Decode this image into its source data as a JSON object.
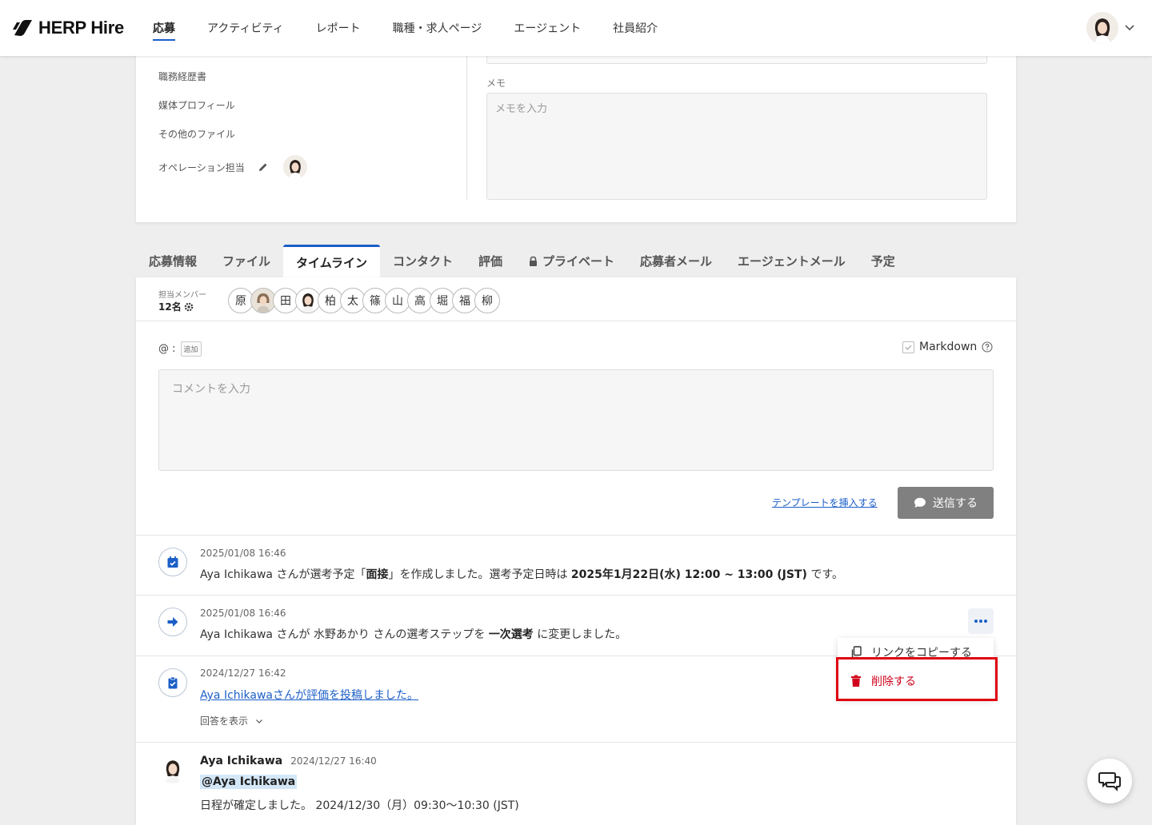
{
  "header": {
    "logo_text": "HERP Hire",
    "nav": [
      "応募",
      "アクティビティ",
      "レポート",
      "職種・求人ページ",
      "エージェント",
      "社員紹介"
    ],
    "active_nav": "応募"
  },
  "candidate_panel": {
    "links": [
      "職務経歴書",
      "媒体プロフィール",
      "その他のファイル"
    ],
    "operation_owner_label": "オペレーション担当",
    "memo_label": "メモ",
    "memo_placeholder": "メモを入力"
  },
  "tabs": [
    "応募情報",
    "ファイル",
    "タイムライン",
    "コンタクト",
    "評価",
    "プライベート",
    "応募者メール",
    "エージェントメール",
    "予定"
  ],
  "active_tab": "タイムライン",
  "members": {
    "label": "担当メンバー",
    "count": "12名",
    "chips": [
      "原",
      "",
      "田",
      "",
      "柏",
      "太",
      "篠",
      "山",
      "高",
      "堀",
      "福",
      "柳"
    ]
  },
  "composer": {
    "mention_prefix": "@ :",
    "add_label": "追加",
    "markdown_label": "Markdown",
    "comment_placeholder": "コメントを入力",
    "template_link": "テンプレートを挿入する",
    "send_label": "送信する"
  },
  "timeline": [
    {
      "type": "calendar",
      "date": "2025/01/08 16:46",
      "parts": [
        "Aya Ichikawa さんが選考予定「",
        "面接",
        "」を作成しました。選考予定日時は ",
        "2025年1月22日(水) 12:00 ~ 13:00 (JST)",
        " です。"
      ]
    },
    {
      "type": "step",
      "date": "2025/01/08 16:46",
      "parts": [
        "Aya Ichikawa さんが 水野あかり さんの選考ステップを ",
        "一次選考",
        " に変更しました。"
      ]
    },
    {
      "type": "evaluation",
      "date": "2024/12/27 16:42",
      "link_text": "Aya Ichikawaさんが評価を投稿しました。",
      "answers_label": "回答を表示"
    }
  ],
  "comment": {
    "author": "Aya Ichikawa",
    "time": "2024/12/27 16:40",
    "mention": "@Aya Ichikawa",
    "body": "日程が確定しました。 2024/12/30（月）09:30～10:30 (JST)"
  },
  "menu": {
    "copy_link": "リンクをコピーする",
    "delete": "削除する"
  },
  "colors": {
    "accent": "#1c5fc7",
    "danger": "#d0021b",
    "highlight_frame": "#e0000f",
    "send_button": "#808080"
  }
}
